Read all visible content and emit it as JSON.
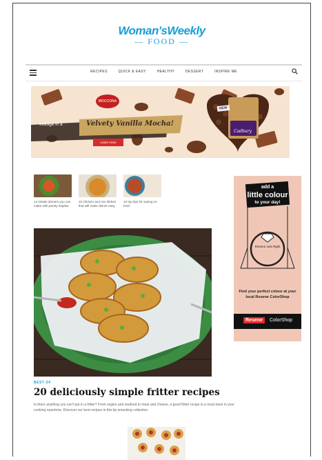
{
  "header": {
    "logo_text": "Woman'sWeekly",
    "logo_sub": "— FOOD —"
  },
  "nav": {
    "items": [
      "RECIPES",
      "QUICK & EASY",
      "HEALTHY",
      "DESSERT",
      "INSPIRE ME"
    ],
    "menu_icon": "hamburger-icon",
    "search_icon": "search-icon"
  },
  "banner": {
    "brand": "MOCCONA",
    "headline_prefix": "Indulge in a",
    "headline": "Velvety Vanilla Mocha!",
    "cta": "Learn more",
    "new_badge": "NEW",
    "product_brand": "Cadbury"
  },
  "sidebar_ad": {
    "line1": "add a",
    "line2": "little colour",
    "line3": "to your day!",
    "ring_label": "Resene Just Right",
    "body": "Find your perfect colour at your local Resene ColorShop",
    "logo_brand": "Resene",
    "logo_shop": "ColorShop"
  },
  "thumbs": [
    {
      "caption": "14 simple dinners you can make with pantry staples"
    },
    {
      "caption": "15 chicken and rice dishes that will make dinner easy"
    },
    {
      "caption": "10 top tips for saving on food"
    }
  ],
  "article": {
    "category": "BEST OF",
    "title": "20 deliciously simple fritter recipes",
    "description": "Is there anything you can't put in a fritter? From vegies and seafood to meat and cheese, a good fritter recipe is a must-have in your cooking repertoire. Discover our best recipes in this lip-smacking collection."
  },
  "colors": {
    "accent": "#1a9fd6",
    "ad_bg": "#f0c7b6",
    "banner_bg": "#f6e3d0",
    "cta": "#d62b2b"
  }
}
